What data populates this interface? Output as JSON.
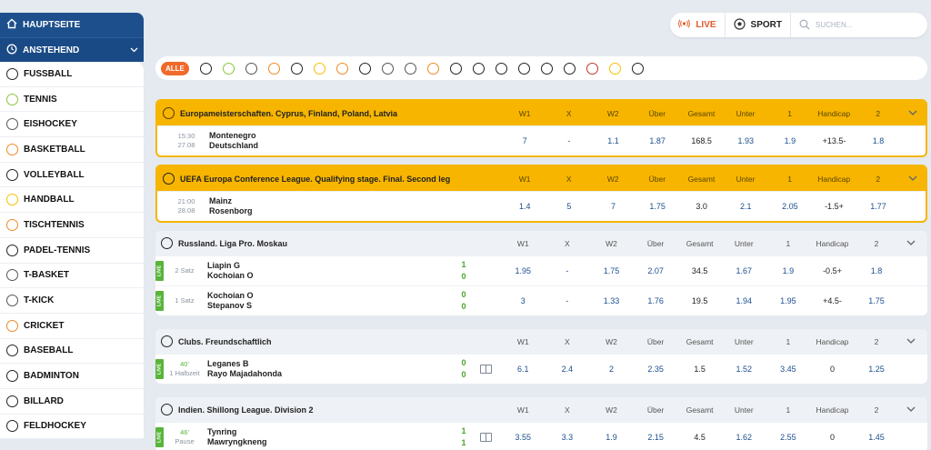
{
  "sidebar": {
    "top": [
      {
        "label": "HAUPTSEITE",
        "icon": "home-icon"
      },
      {
        "label": "ANSTEHEND",
        "icon": "clock-icon"
      }
    ],
    "items": [
      {
        "label": "FUSSBALL",
        "icon": "football-icon",
        "color": "#222222"
      },
      {
        "label": "TENNIS",
        "icon": "tennis-icon",
        "color": "#8bc53f"
      },
      {
        "label": "EISHOCKEY",
        "icon": "hockey-puck-icon",
        "color": "#555555"
      },
      {
        "label": "BASKETBALL",
        "icon": "basketball-icon",
        "color": "#f08a24"
      },
      {
        "label": "VOLLEYBALL",
        "icon": "volleyball-icon",
        "color": "#222222"
      },
      {
        "label": "HANDBALL",
        "icon": "handball-icon",
        "color": "#f7c000"
      },
      {
        "label": "TISCHTENNIS",
        "icon": "table-tennis-icon",
        "color": "#f08a24"
      },
      {
        "label": "PADEL-TENNIS",
        "icon": "padel-icon",
        "color": "#222222"
      },
      {
        "label": "T-BASKET",
        "icon": "t-basket-icon",
        "color": "#555555"
      },
      {
        "label": "T-KICK",
        "icon": "t-kick-icon",
        "color": "#555555"
      },
      {
        "label": "CRICKET",
        "icon": "cricket-icon",
        "color": "#f08a24"
      },
      {
        "label": "BASEBALL",
        "icon": "baseball-icon",
        "color": "#222222"
      },
      {
        "label": "BADMINTON",
        "icon": "badminton-icon",
        "color": "#222222"
      },
      {
        "label": "BILLARD",
        "icon": "billiard-icon",
        "color": "#222222"
      },
      {
        "label": "FELDHOCKEY",
        "icon": "field-hockey-icon",
        "color": "#222222"
      }
    ]
  },
  "topbar": {
    "live_label": "LIVE",
    "sport_label": "SPORT",
    "search_placeholder": "SUCHEN..."
  },
  "filter": {
    "all_label": "ALLE",
    "icons": [
      "football-icon",
      "tennis-icon",
      "hockey-puck-icon",
      "basketball-icon",
      "volleyball-icon",
      "handball-icon",
      "table-tennis-icon",
      "padel-icon",
      "t-basket-icon",
      "t-kick-icon",
      "cricket-icon",
      "baseball-icon",
      "badminton-icon",
      "billiard-icon",
      "field-hockey-icon",
      "kabaddi-icon",
      "shooting-icon",
      "dota2-icon",
      "valorant-shield-icon",
      "valorant-icon"
    ]
  },
  "columns": [
    "W1",
    "X",
    "W2",
    "Über",
    "Gesamt",
    "Unter",
    "1",
    "Handicap",
    "2"
  ],
  "blocks": [
    {
      "title": "Europameisterschaften. Cyprus, Finland, Poland, Latvia",
      "sport_icon": "basketball-icon",
      "highlight": true,
      "events": [
        {
          "live": false,
          "time1": "15:30",
          "time2": "27.08",
          "team1": "Montenegro",
          "team2": "Deutschland",
          "score1": "",
          "score2": "",
          "odds": [
            "7",
            "-",
            "1.1",
            "1.87",
            "168.5",
            "1.93",
            "1.9",
            "+13.5-",
            "1.8"
          ]
        }
      ]
    },
    {
      "title": "UEFA Europa Conference League. Qualifying stage. Final. Second leg",
      "sport_icon": "football-icon",
      "highlight": true,
      "events": [
        {
          "live": false,
          "time1": "21:00",
          "time2": "28.08",
          "team1": "Mainz",
          "team2": "Rosenborg",
          "score1": "",
          "score2": "",
          "odds": [
            "1.4",
            "5",
            "7",
            "1.75",
            "3.0",
            "2.1",
            "2.05",
            "-1.5+",
            "1.77"
          ]
        }
      ]
    },
    {
      "title": "Russland. Liga Pro. Moskau",
      "sport_icon": "table-tennis-icon",
      "highlight": false,
      "events": [
        {
          "live": true,
          "time1": "2 Satz",
          "time2": "",
          "team1": "Liapin G",
          "team2": "Kochoian O",
          "score1": "1",
          "score2": "0",
          "odds": [
            "1.95",
            "-",
            "1.75",
            "2.07",
            "34.5",
            "1.67",
            "1.9",
            "-0.5+",
            "1.8"
          ]
        },
        {
          "live": true,
          "time1": "1 Satz",
          "time2": "",
          "team1": "Kochoian O",
          "team2": "Stepanov S",
          "score1": "0",
          "score2": "0",
          "odds": [
            "3",
            "-",
            "1.33",
            "1.76",
            "19.5",
            "1.94",
            "1.95",
            "+4.5-",
            "1.75"
          ]
        }
      ]
    },
    {
      "title": "Clubs. Freundschaftlich",
      "sport_icon": "football-icon",
      "highlight": false,
      "events": [
        {
          "live": true,
          "time1": "40'",
          "time2": "1 Halbzeit",
          "team1": "Leganes B",
          "team2": "Rayo Majadahonda",
          "score1": "0",
          "score2": "0",
          "field": true,
          "odds": [
            "6.1",
            "2.4",
            "2",
            "2.35",
            "1.5",
            "1.52",
            "3.45",
            "0",
            "1.25"
          ]
        }
      ]
    },
    {
      "title": "Indien. Shillong League. Division 2",
      "sport_icon": "football-icon",
      "highlight": false,
      "events": [
        {
          "live": true,
          "time1": "46'",
          "time2": "Pause",
          "team1": "Tynring",
          "team2": "Mawryngkneng",
          "score1": "1",
          "score2": "1",
          "field": true,
          "odds": [
            "3.55",
            "3.3",
            "1.9",
            "2.15",
            "4.5",
            "1.62",
            "2.55",
            "0",
            "1.45"
          ]
        }
      ]
    }
  ],
  "live_badge": "LIVE"
}
